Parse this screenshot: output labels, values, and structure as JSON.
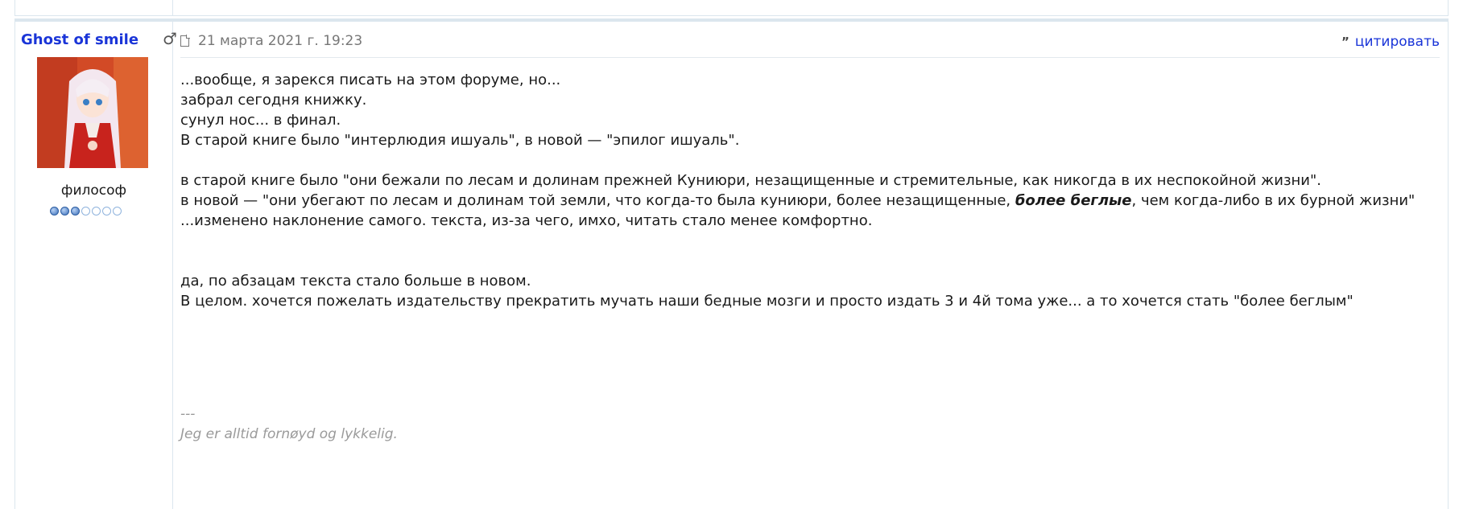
{
  "post": {
    "author": {
      "name": "Ghost of smile",
      "gender_icon": "male-icon",
      "rank": "философ",
      "rank_level": 3,
      "rank_max": 7
    },
    "date": "21 марта 2021 г. 19:23",
    "quote_label": "цитировать",
    "body": {
      "line1": "...вообще, я зарекся писать на этом форуме, но...",
      "line2": "забрал сегодня книжку.",
      "line3": "сунул нос... в финал.",
      "line4": "В старой книге было \"интерлюдия ишуаль\", в новой — \"эпилог ишуаль\".",
      "line5": "в старой книге было \"они бежали по лесам и долинам прежней Куниюри, незащищенные и стремительные, как никогда в их неспокойной жизни\".",
      "line6_pre": "в новой — \"они убегают по лесам и долинам той земли, что когда-то была куниюри, более незащищенные, ",
      "line6_em": "более беглые",
      "line6_post": ", чем когда-либо в их бурной жизни\"",
      "line7": "...изменено наклонение самого. текста, из-за чего, имхо, читать стало менее комфортно.",
      "line8": "да, по абзацам текста стало больше в новом.",
      "line9": "В целом. хочется пожелать издательству прекратить мучать наши бедные мозги и просто издать 3 и 4й тома уже... а то хочется стать \"более беглым\""
    },
    "signature": {
      "divider": "---",
      "text": "Jeg er alltid fornøyd og lykkelig."
    }
  }
}
